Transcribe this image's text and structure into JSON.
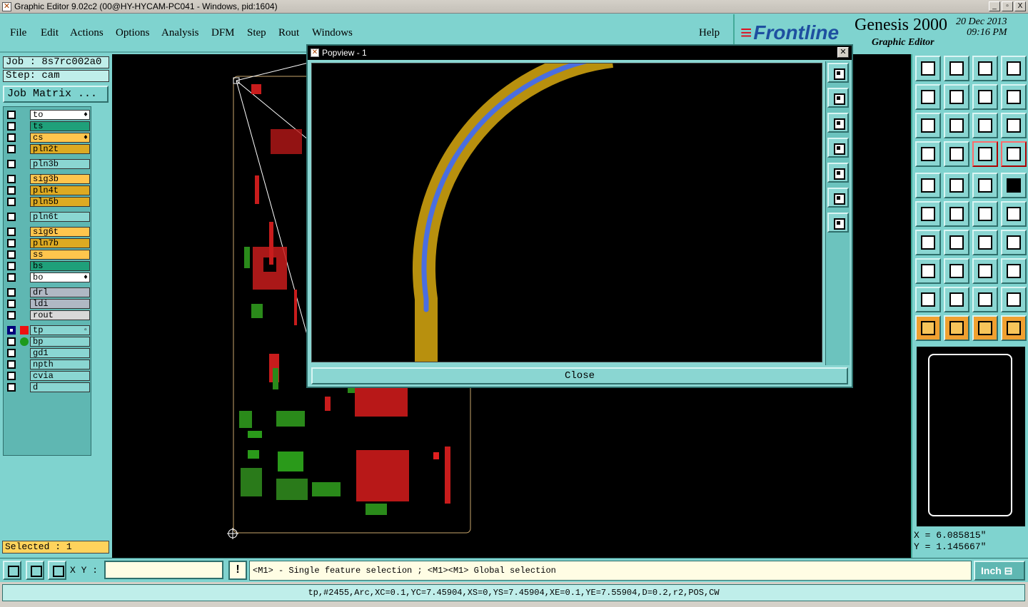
{
  "window": {
    "title": "Graphic Editor 9.02c2 (00@HY-HYCAM-PC041 - Windows, pid:1604)",
    "buttons": [
      "_",
      "▫",
      "X"
    ]
  },
  "menu": {
    "file": "File",
    "edit": "Edit",
    "actions": "Actions",
    "options": "Options",
    "analysis": "Analysis",
    "dfm": "DFM",
    "step": "Step",
    "rout": "Rout",
    "windows": "Windows",
    "help": "Help"
  },
  "brand": {
    "logo": "Frontline",
    "product": "Genesis 2000",
    "subtitle": "Graphic Editor",
    "date": "20 Dec 2013",
    "time": "09:16 PM"
  },
  "left": {
    "job": "Job : 8s7rc002a0",
    "step": "Step: cam",
    "job_matrix": "Job Matrix ...",
    "selected": "Selected : 1"
  },
  "layers": [
    {
      "name": "to",
      "color": "#ffffff",
      "flag": "♦"
    },
    {
      "name": "ts",
      "color": "#1fa07a",
      "flag": ""
    },
    {
      "name": "cs",
      "color": "#ffc54d",
      "flag": "♦"
    },
    {
      "name": "pln2t",
      "color": "#ddaa22",
      "flag": ""
    },
    {
      "name": "pln3b",
      "color": "#8ad6d2",
      "flag": ""
    },
    {
      "name": "sig3b",
      "color": "#ffc54d",
      "flag": ""
    },
    {
      "name": "pln4t",
      "color": "#ddaa22",
      "flag": ""
    },
    {
      "name": "pln5b",
      "color": "#ddaa22",
      "flag": ""
    },
    {
      "name": "pln6t",
      "color": "#8ad6d2",
      "flag": ""
    },
    {
      "name": "sig6t",
      "color": "#ffc54d",
      "flag": ""
    },
    {
      "name": "pln7b",
      "color": "#ddaa22",
      "flag": ""
    },
    {
      "name": "ss",
      "color": "#ffc54d",
      "flag": ""
    },
    {
      "name": "bs",
      "color": "#1fa07a",
      "flag": ""
    },
    {
      "name": "bo",
      "color": "#ffffff",
      "flag": "♦"
    },
    {
      "name": "drl",
      "color": "#b0b8c4",
      "flag": ""
    },
    {
      "name": "ldi",
      "color": "#b0b8c4",
      "flag": ""
    },
    {
      "name": "rout",
      "color": "#d8d8d8",
      "flag": ""
    },
    {
      "name": "tp",
      "color": "#8ad6d2",
      "flag": "▫"
    },
    {
      "name": "bp",
      "color": "#8ad6d2",
      "flag": ""
    },
    {
      "name": "gd1",
      "color": "#8ad6d2",
      "flag": ""
    },
    {
      "name": "npth",
      "color": "#8ad6d2",
      "flag": ""
    },
    {
      "name": "cvia",
      "color": "#8ad6d2",
      "flag": ""
    },
    {
      "name": "d",
      "color": "#8ad6d2",
      "flag": ""
    }
  ],
  "popview": {
    "title": "Popview - 1",
    "close_label": "Close",
    "x_icon": "✕"
  },
  "coords": {
    "x": "X = 6.085815\"",
    "y": "Y = 1.145667\""
  },
  "bottom": {
    "xy_label": "X Y :",
    "xy_value": "",
    "warn": "!",
    "message": "<M1> - Single feature selection ; <M1><M1> Global selection",
    "unit": "Inch ⊟"
  },
  "status": {
    "feature": "tp,#2455,Arc,XC=0.1,YC=7.45904,XS=0,YS=7.45904,XE=0.1,YE=7.55904,D=0.2,r2,POS,CW"
  },
  "colors": {
    "accent": "#7fd3cf",
    "copper": "#b8900e",
    "trace": "#4a6ee0"
  }
}
